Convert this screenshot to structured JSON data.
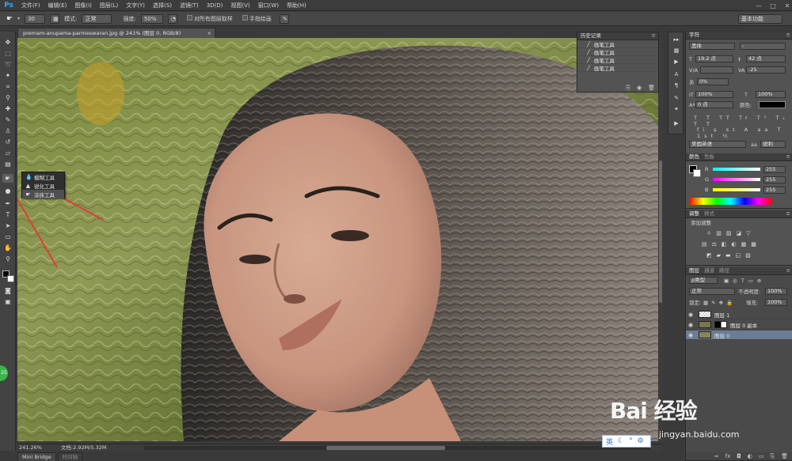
{
  "app": {
    "logo": "Ps",
    "menus": [
      "文件(F)",
      "编辑(E)",
      "图像(I)",
      "图层(L)",
      "文字(Y)",
      "选择(S)",
      "滤镜(T)",
      "3D(D)",
      "视图(V)",
      "窗口(W)",
      "帮助(H)"
    ],
    "window_controls": [
      "—",
      "□",
      "✕"
    ]
  },
  "options_bar": {
    "size_value": "30",
    "mode_label": "模式:",
    "mode_value": "正常",
    "strength_label": "强度:",
    "strength_value": "50%",
    "sample_all_label": "对所有图层取样",
    "finger_paint_label": "手指绘画",
    "workspace": "基本功能"
  },
  "document": {
    "tab_title": "premam-anupama-parmeswaran.jpg @ 241% (图层 0, RGB/8)",
    "tab_close": "×",
    "zoom": "241.26%",
    "doc_size": "文档:2.92M/5.32M"
  },
  "bottom_tabs": [
    "Mini Bridge",
    "时间轴"
  ],
  "flyout": {
    "items": [
      {
        "icon": "droplet-icon",
        "label": "模糊工具"
      },
      {
        "icon": "triangle-icon",
        "label": "锐化工具"
      },
      {
        "icon": "finger-icon",
        "label": "涂抹工具"
      }
    ]
  },
  "history": {
    "title": "历史记录",
    "rows": [
      "画笔工具",
      "画笔工具",
      "画笔工具",
      "画笔工具"
    ]
  },
  "character": {
    "title": "字符",
    "font_family": "黑体",
    "font_style": "-",
    "font_size": "19.2 点",
    "leading": "42 点",
    "tracking": "-25",
    "kerning": "",
    "scale_pct": "0%",
    "vscale": "100%",
    "hscale": "100%",
    "baseline": "0 点",
    "color_label": "颜色:",
    "language": "美国英语",
    "aa_label": "aa",
    "aa_value": "锐利"
  },
  "color_panel": {
    "tabs": [
      "颜色",
      "色板"
    ],
    "channels": [
      {
        "name": "R",
        "value": "255"
      },
      {
        "name": "G",
        "value": "255"
      },
      {
        "name": "B",
        "value": "255"
      }
    ]
  },
  "adjust_panel": {
    "tabs": [
      "调整",
      "样式"
    ],
    "label": "添加调整"
  },
  "layers_panel": {
    "tabs": [
      "图层",
      "通道",
      "路径"
    ],
    "filter_label": "ρ类型",
    "blend_mode": "正常",
    "opacity_label": "不透明度:",
    "opacity_value": "100%",
    "lock_label": "锁定:",
    "fill_label": "填充:",
    "fill_value": "100%",
    "layers": [
      {
        "name": "图层 1",
        "selected": false
      },
      {
        "name": "图层 0 副本",
        "selected": false
      },
      {
        "name": "图层 0",
        "selected": true
      }
    ]
  },
  "watermark": {
    "brand": "Bai 经验",
    "url": "jingyan.baidu.com"
  },
  "ime": {
    "label": "英"
  },
  "badge": "25",
  "colors": {
    "accent_selected_layer": "#6b7c95",
    "ps_logo_blue": "#31a8ff",
    "arrow_red": "#e23a3a"
  }
}
